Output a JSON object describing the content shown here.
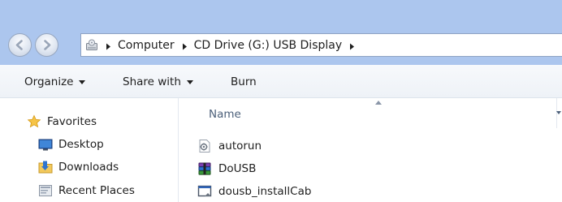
{
  "address": {
    "crumbs": [
      "Computer",
      "CD Drive (G:) USB Display"
    ]
  },
  "toolbar": {
    "organize_label": "Organize",
    "share_label": "Share with",
    "burn_label": "Burn"
  },
  "nav": {
    "favorites_label": "Favorites",
    "items": [
      {
        "label": "Desktop",
        "icon": "desktop-icon"
      },
      {
        "label": "Downloads",
        "icon": "downloads-folder-icon"
      },
      {
        "label": "Recent Places",
        "icon": "recent-places-icon"
      }
    ]
  },
  "list": {
    "column_name": "Name",
    "files": [
      {
        "name": "autorun",
        "icon": "settings-file-icon"
      },
      {
        "name": "DoUSB",
        "icon": "archive-icon"
      },
      {
        "name": "dousb_installCab",
        "icon": "installer-icon"
      }
    ]
  },
  "colors": {
    "chrome": "#acc6ee",
    "command_bar": "#f2f5f9",
    "column_header_text": "#4c607a"
  }
}
